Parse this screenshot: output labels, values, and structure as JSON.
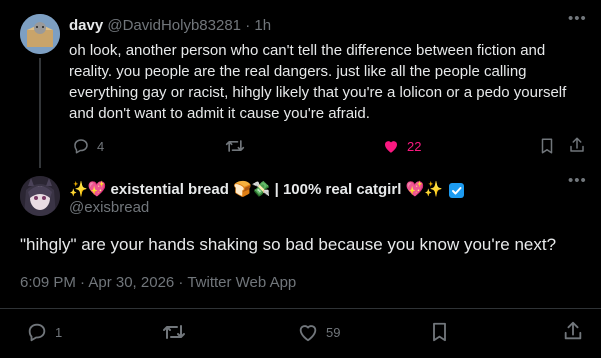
{
  "reply": {
    "display_name": "davy",
    "handle": "@DavidHolyb83281",
    "separator": "·",
    "time": "1h",
    "text": "oh look, another person who can't tell the difference between fiction and reality. you people are the real dangers. just like all the people calling everything gay or racist, hihgly likely that you're a lolicon or a pedo yourself and don't want to admit it cause you're afraid.",
    "replies": "4",
    "likes": "22",
    "liked_color": "#f91880"
  },
  "main": {
    "display_name": "✨💖 existential bread 🍞💸 | 100% real catgirl 💖✨",
    "handle": "@exisbread",
    "text": "\"hihgly\" are your hands shaking so bad because you know you're next?",
    "meta": "6:09 PM · Apr 30, 2026 · Twitter Web App",
    "replies": "1",
    "likes": "59"
  },
  "icons": {
    "reply": "reply-icon",
    "retweet": "retweet-icon",
    "like": "heart-icon",
    "bookmark": "bookmark-icon",
    "share": "share-icon",
    "more": "more-icon",
    "verified": "verified-badge-icon"
  },
  "colors": {
    "background": "#000000",
    "text": "#e7e9ea",
    "muted": "#71767b",
    "accent": "#1d9bf0"
  }
}
